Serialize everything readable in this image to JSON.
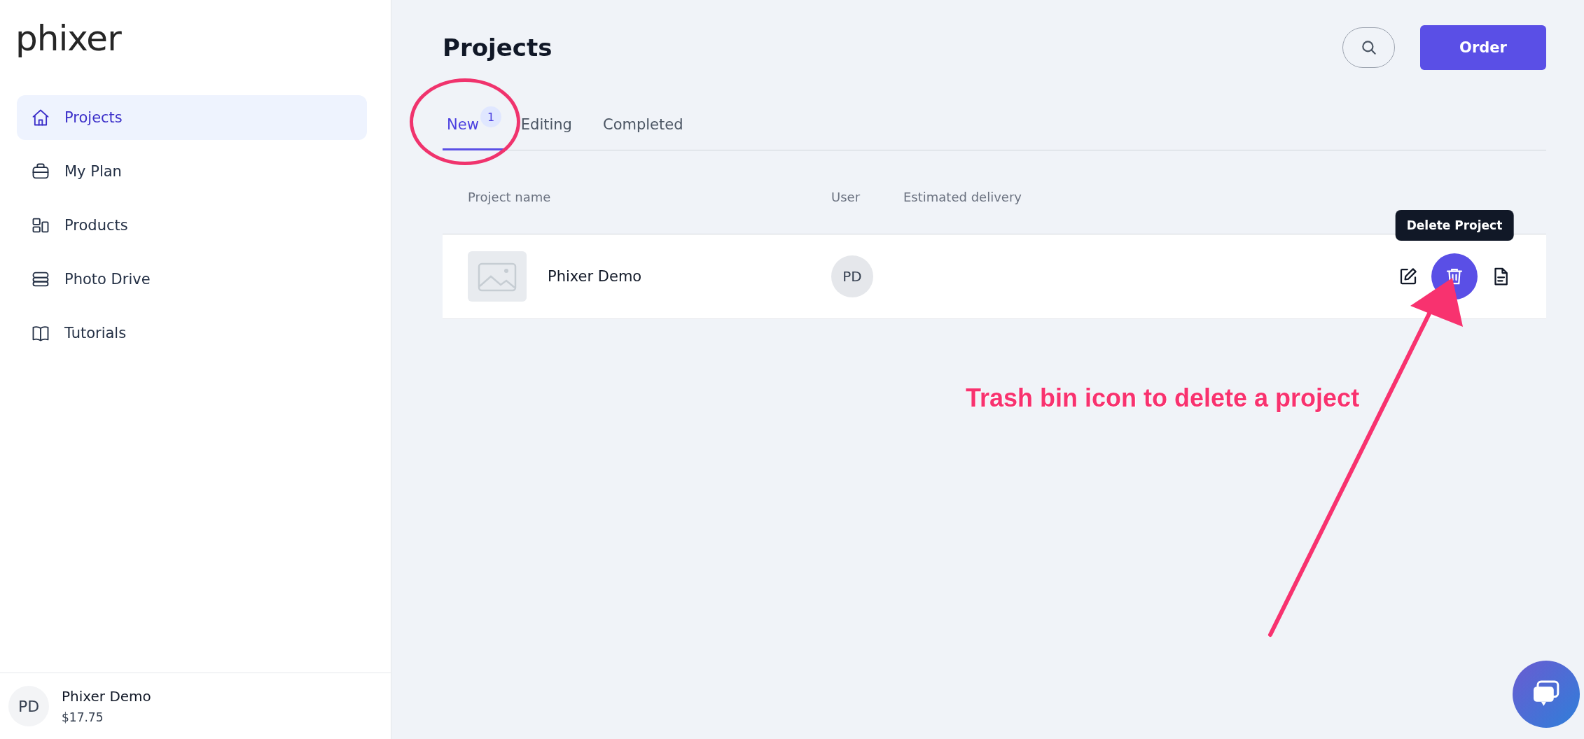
{
  "sidebar": {
    "logo": "phixer",
    "items": [
      {
        "label": "Projects",
        "kind": "home",
        "selected": true
      },
      {
        "label": "My Plan",
        "kind": "briefcase",
        "selected": false
      },
      {
        "label": "Products",
        "kind": "blocks",
        "selected": false
      },
      {
        "label": "Photo Drive",
        "kind": "drive",
        "selected": false
      },
      {
        "label": "Tutorials",
        "kind": "book",
        "selected": false
      }
    ],
    "account": {
      "initials": "PD",
      "name": "Phixer Demo",
      "balance": "$17.75"
    }
  },
  "header": {
    "title": "Projects",
    "order_button": "Order"
  },
  "tabs": [
    {
      "label": "New",
      "badge": "1",
      "selected": true
    },
    {
      "label": "Editing",
      "selected": false
    },
    {
      "label": "Completed",
      "selected": false
    }
  ],
  "table": {
    "columns": [
      "Project name",
      "User",
      "Estimated delivery"
    ],
    "rows": [
      {
        "name": "Phixer Demo",
        "user": "PD",
        "tooltip": "Delete Project"
      }
    ]
  },
  "annotation": {
    "text": "Trash bin icon to delete a project"
  }
}
